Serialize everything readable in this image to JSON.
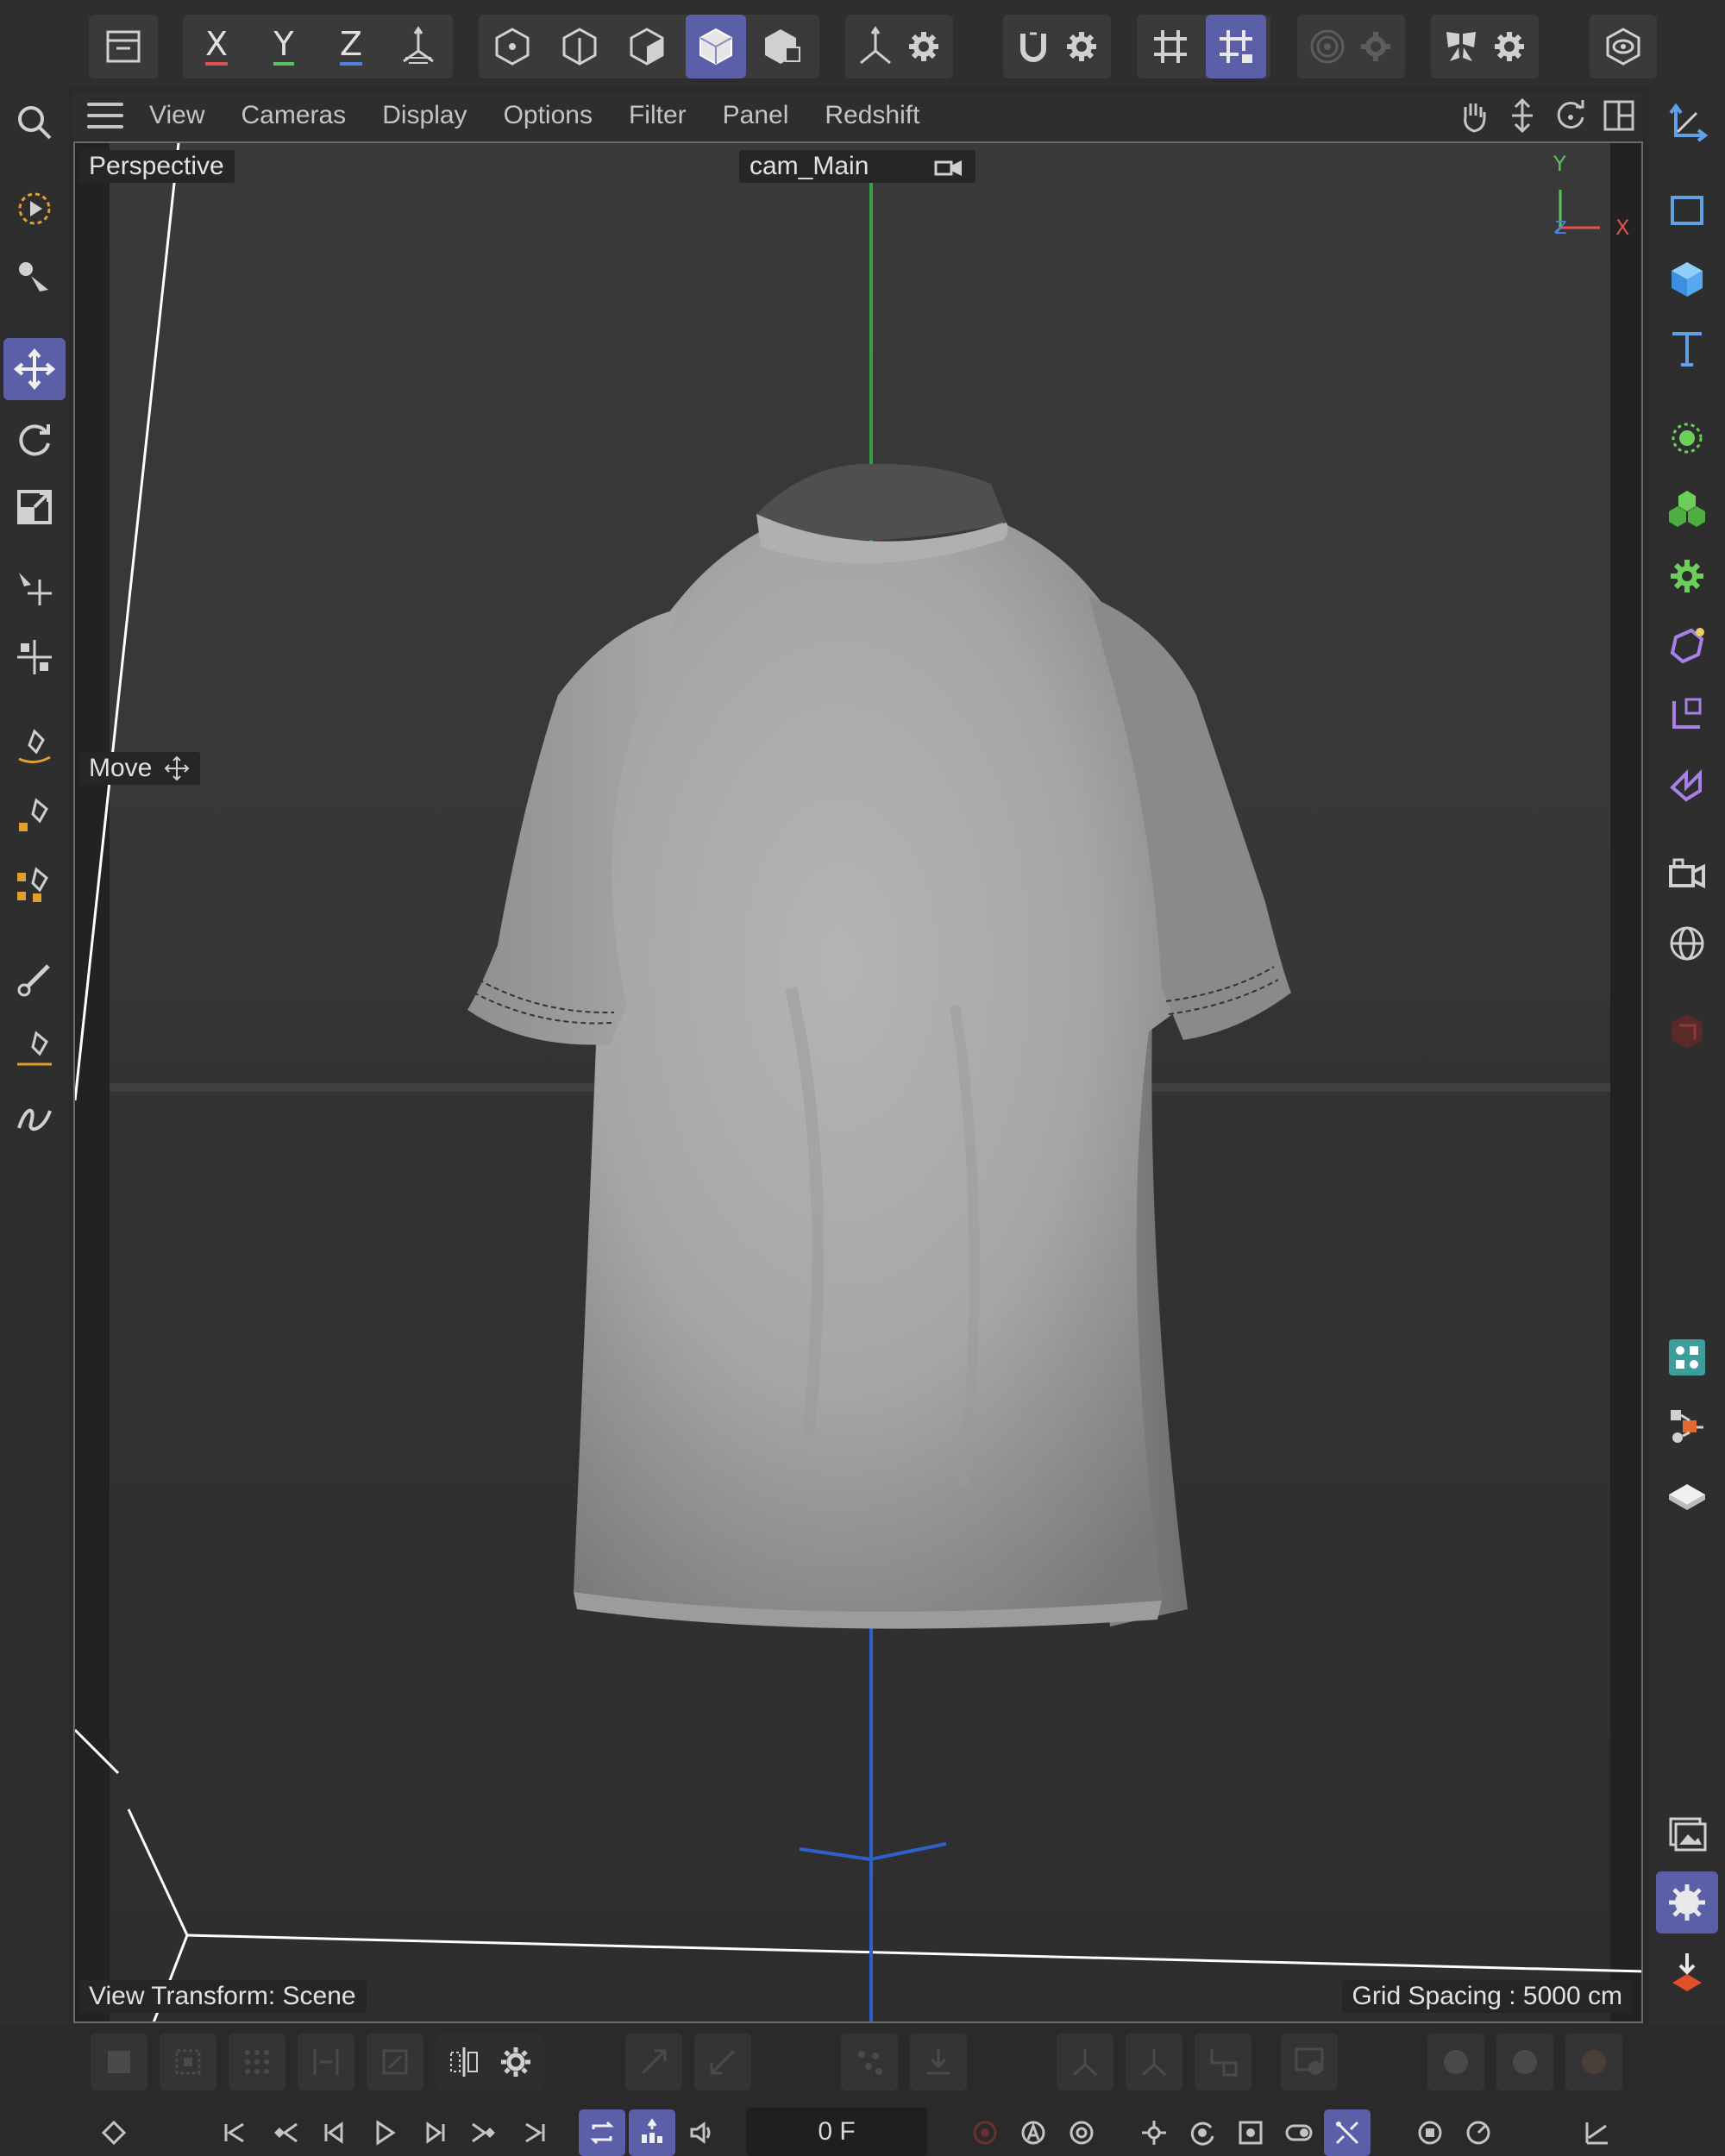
{
  "toolbar": {
    "axis_x": "X",
    "axis_y": "Y",
    "axis_z": "Z"
  },
  "menu": {
    "items": [
      "View",
      "Cameras",
      "Display",
      "Options",
      "Filter",
      "Panel",
      "Redshift"
    ]
  },
  "viewport": {
    "view_name": "Perspective",
    "camera_name": "cam_Main",
    "tool_hint": "Move",
    "view_transform": "View Transform: Scene",
    "grid_spacing": "Grid Spacing : 5000 cm",
    "gizmo_y": "Y",
    "gizmo_x": "X",
    "gizmo_z": "Z"
  },
  "timeline": {
    "current_frame": "0 F"
  },
  "colors": {
    "accent": "#5b5fa8",
    "axis_x": "#e05050",
    "axis_y": "#5cc25c",
    "axis_z": "#4f82e0",
    "green_axis_line": "#35a043",
    "blue_axis_line": "#2f5fc8"
  },
  "icons": [
    "undo-history-icon",
    "move-icon",
    "rotate-icon",
    "scale-icon",
    "search-icon",
    "camera-icon",
    "globe-icon",
    "cube-icon",
    "text-icon",
    "gear-icon",
    "magnet-icon",
    "grid-snap-icon"
  ]
}
